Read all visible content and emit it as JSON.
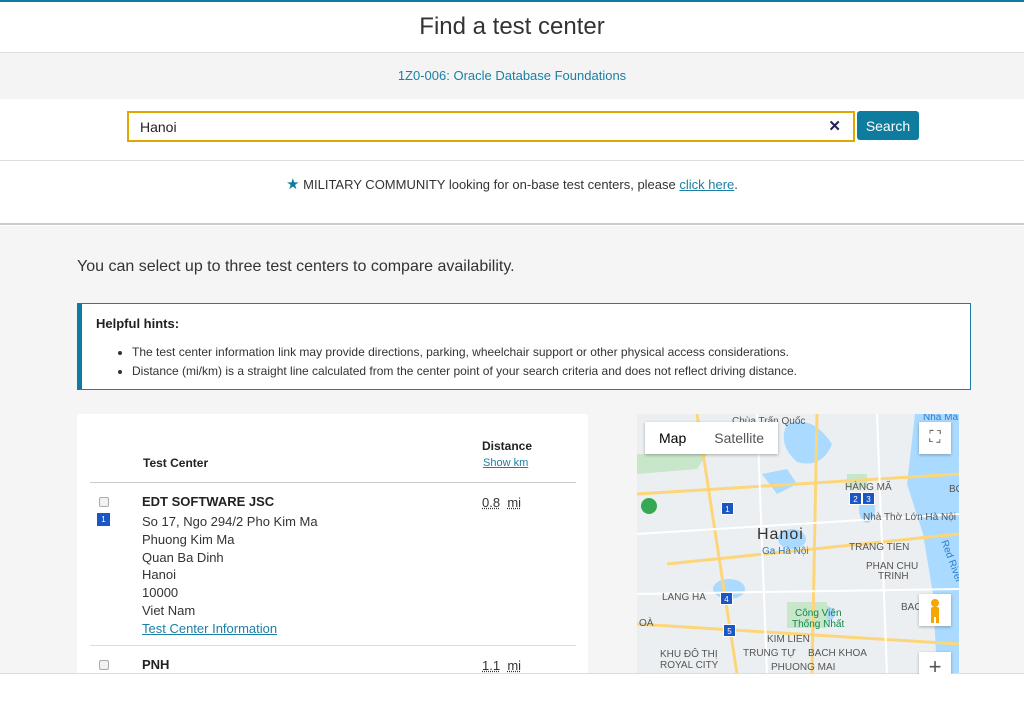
{
  "header": {
    "title": "Find a test center"
  },
  "exam": {
    "link": "1Z0-006: Oracle Database Foundations"
  },
  "search": {
    "value": "Hanoi",
    "clear_icon": "✕",
    "button_label": "Search"
  },
  "military": {
    "prefix": "MILITARY COMMUNITY looking for on-base test centers, please ",
    "link": "click here",
    "suffix": "."
  },
  "intro": "You can select up to three test centers to compare availability.",
  "hints": {
    "title": "Helpful hints:",
    "items": [
      "The test center information link may provide directions, parking, wheelchair support or other physical access considerations.",
      "Distance (mi/km) is a straight line calculated from the center point of your search criteria and does not reflect driving distance."
    ]
  },
  "list": {
    "col_test_center": "Test Center",
    "col_distance": "Distance",
    "show_km": "Show km",
    "rows": [
      {
        "pin": "1",
        "name": "EDT SOFTWARE JSC",
        "address": [
          "So 17, Ngo 294/2 Pho Kim Ma",
          "Phuong Kim Ma",
          "Quan Ba Dinh",
          "Hanoi",
          "10000",
          "Viet Nam"
        ],
        "info_link": "Test Center Information",
        "distance": "0.8",
        "unit": "mi"
      },
      {
        "name": "PNH",
        "distance": "1.1",
        "unit": "mi"
      }
    ]
  },
  "map": {
    "tab_map": "Map",
    "tab_satellite": "Satellite",
    "fullscreen_icon": "⛶",
    "zoom_in": "+",
    "labels": {
      "chua_tran_quoc": "Chùa Trấn Quốc",
      "nha_ma": "Nhà Ma",
      "hang_ma": "HÀNG MÃ",
      "hanoi": "Hanoi",
      "ga_ha_noi": "Ga Hà Nội",
      "nha_tho": "Nhà Thờ Lớn Hà Nội",
      "trang_tien": "TRANG TIEN",
      "phan_chu_trinh_1": "PHAN CHU",
      "phan_chu_trinh_2": "TRINH",
      "lang_ha": "LANG HA",
      "cong_vien_1": "Công Viên",
      "cong_vien_2": "Thống Nhất",
      "kim_lien": "KIM LIEN",
      "trung_tu": "TRUNG TỰ",
      "bach_khoa": "BACH KHOA",
      "khu_do_thi_1": "KHU ĐÔ THỊ",
      "khu_do_thi_2": "ROYAL CITY",
      "phuong_mai": "PHUONG MAI",
      "bac": "BAC",
      "bo": "BO",
      "hoa": "OÀ",
      "red_river": "Red River"
    },
    "pins": [
      "1",
      "2",
      "3",
      "4",
      "5"
    ]
  }
}
